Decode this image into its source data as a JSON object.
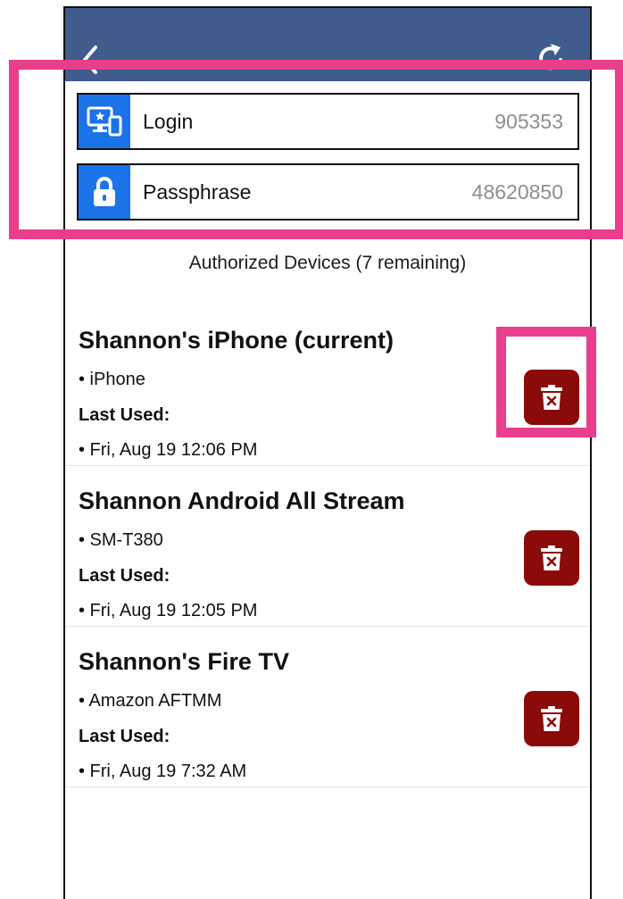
{
  "nav": {
    "back_icon": "chevron-left-icon",
    "refresh_icon": "refresh-icon",
    "bar_color": "#3f5c8c"
  },
  "credentials": [
    {
      "label": "Login",
      "value": "905353",
      "icon": "computer-phone-icon"
    },
    {
      "label": "Passphrase",
      "value": "48620850",
      "icon": "lock-icon"
    }
  ],
  "section_title": "Authorized Devices (7 remaining)",
  "devices": [
    {
      "name": "Shannon's iPhone (current)",
      "model": "• iPhone",
      "last_used_label": "Last Used:",
      "last_used": "• Fri, Aug 19 12:06 PM"
    },
    {
      "name": "Shannon Android All Stream",
      "model": "• SM-T380",
      "last_used_label": "Last Used:",
      "last_used": "• Fri, Aug 19 12:05 PM"
    },
    {
      "name": "Shannon's Fire TV",
      "model": "• Amazon AFTMM",
      "last_used_label": "Last Used:",
      "last_used": "• Fri, Aug 19 7:32 AM"
    }
  ],
  "colors": {
    "accent": "#1a73e8",
    "delete": "#8b0a0a",
    "highlight": "#e83e8c"
  }
}
